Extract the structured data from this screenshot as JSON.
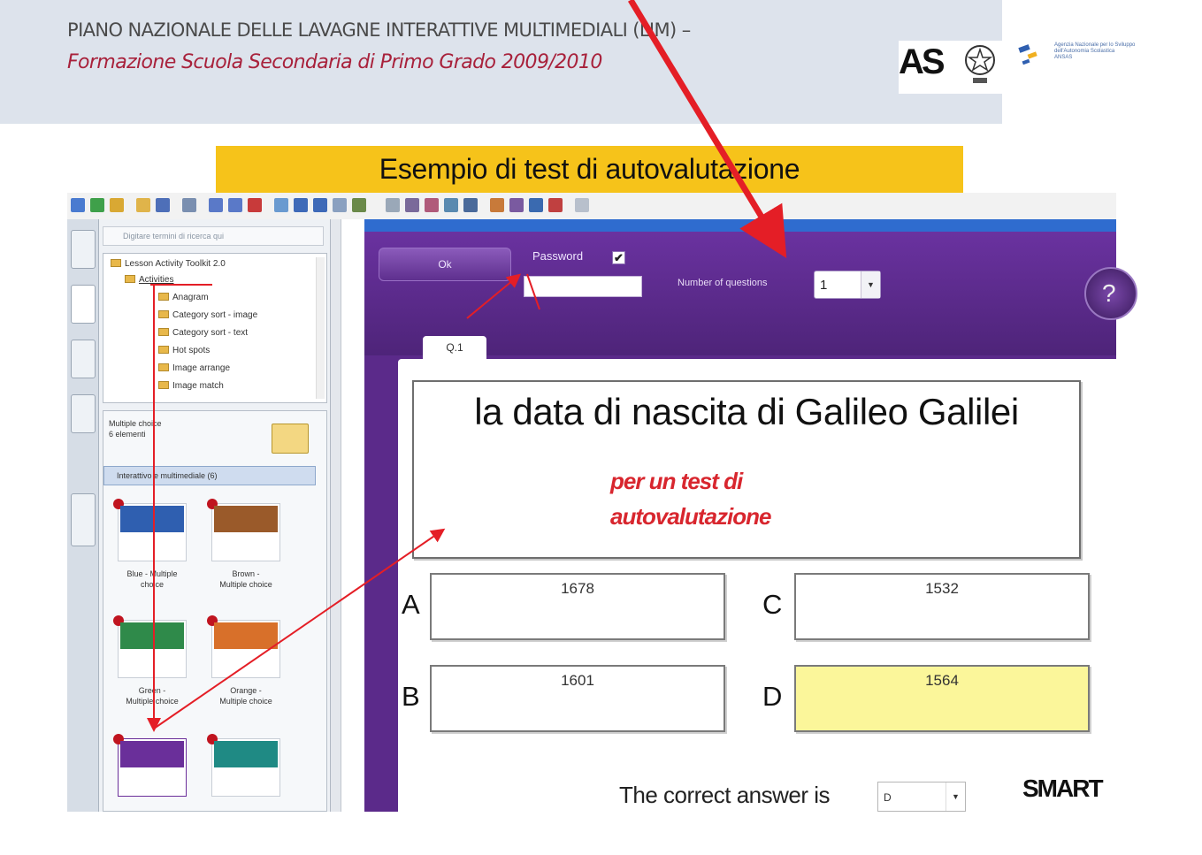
{
  "header": {
    "title": "PIANO NAZIONALE DELLE LAVAGNE INTERATTIVE MULTIMEDIALI (LIM) –",
    "subtitle": "Formazione Scuola Secondaria di Primo Grado 2009/2010"
  },
  "logos": {
    "as_text": "AS",
    "agency_text": "Agenzia Nazionale per lo Sviluppo\ndell'Autonomia Scolastica\nANSAS"
  },
  "banner": {
    "text": "Esempio di test di autovalutazione"
  },
  "gallery": {
    "search_placeholder": "Digitare termini di ricerca qui",
    "tree_root": "Lesson Activity Toolkit 2.0",
    "tree_items": [
      "Activities",
      "Anagram",
      "Category sort - image",
      "Category sort - text",
      "Hot spots",
      "Image arrange",
      "Image match"
    ],
    "pane_header": "Multiple choice\n6 elementi",
    "interactive_label": "Interattivo e multimediale (6)",
    "thumbnails": [
      {
        "label": "Blue - Multiple\nchoice",
        "color": "#2f5fb0"
      },
      {
        "label": "Brown -\nMultiple choice",
        "color": "#9a5a2a"
      },
      {
        "label": "Green -\nMultiple choice",
        "color": "#2f8a4a"
      },
      {
        "label": "Orange -\nMultiple choice",
        "color": "#d8702a"
      },
      {
        "label": "",
        "color": "#6a2f9a"
      },
      {
        "label": "",
        "color": "#1f8a84"
      }
    ]
  },
  "widget": {
    "ok_label": "Ok",
    "password_label": "Password",
    "password_checked": "✔",
    "questions_label": "Number of questions",
    "questions_value": "1",
    "help_label": "?",
    "tab_label": "Q.1",
    "question": "la data di nascita di Galileo Galilei",
    "note": "per un test di autovalutazione",
    "answers": [
      {
        "letter": "A",
        "value": "1678"
      },
      {
        "letter": "B",
        "value": "1601"
      },
      {
        "letter": "C",
        "value": "1532"
      },
      {
        "letter": "D",
        "value": "1564"
      }
    ],
    "correct_label": "The correct answer is",
    "correct_value": "D",
    "brand": "SMART"
  },
  "colors": {
    "accent_red": "#e41e26",
    "banner_yellow": "#f6c31a",
    "widget_purple": "#5b2a8a",
    "correct_highlight": "#fbf69a"
  }
}
